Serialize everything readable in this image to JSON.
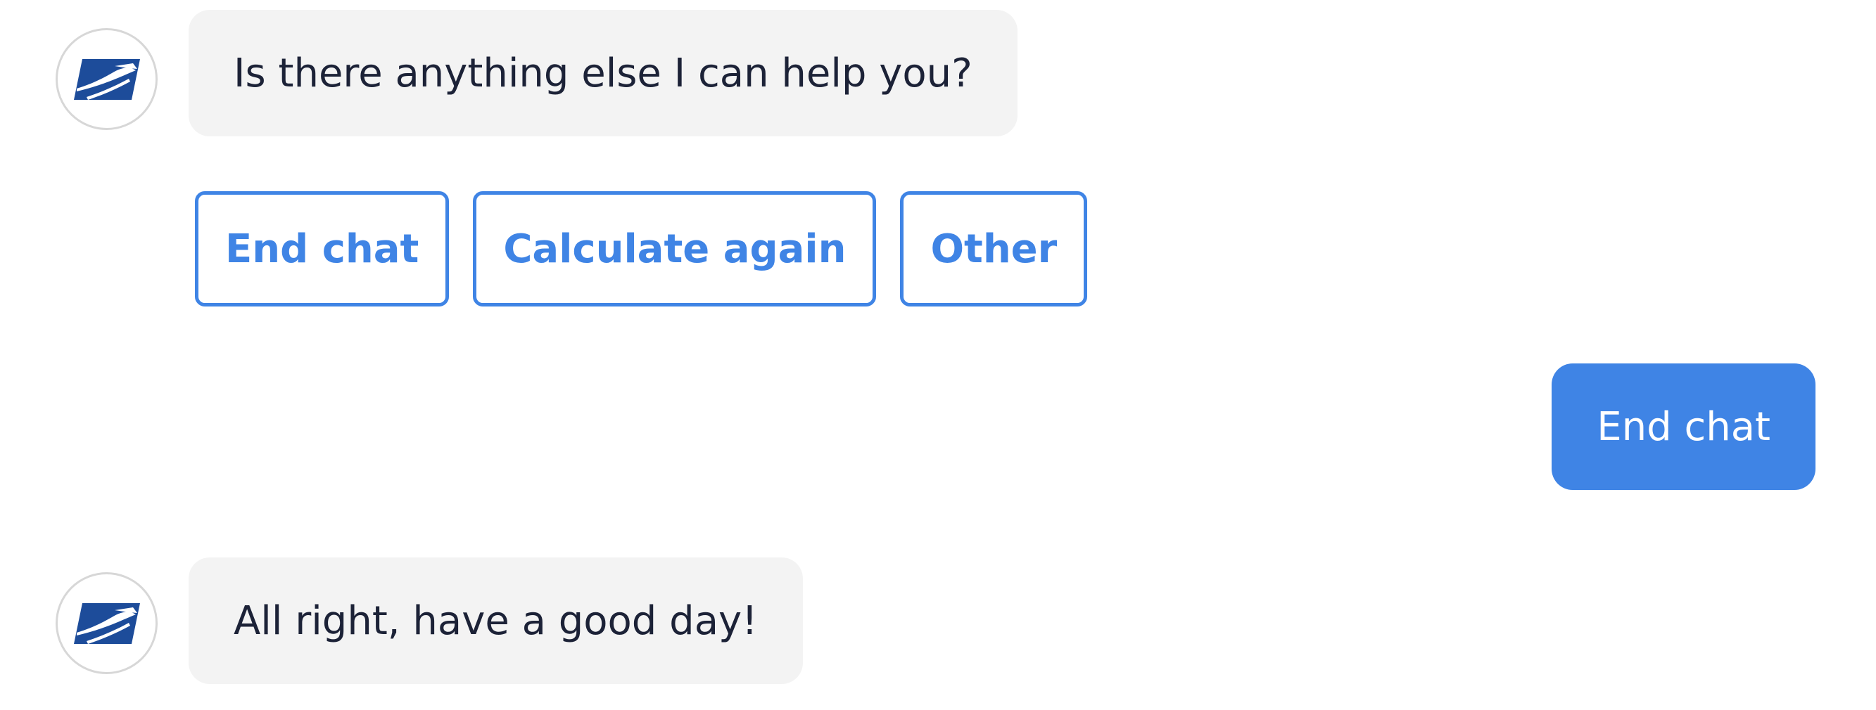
{
  "messages": {
    "bot_question": "Is there anything else I can help you?",
    "user_reply": "End chat",
    "bot_farewell": "All right, have a good day!"
  },
  "quick_replies": [
    {
      "label": "End chat"
    },
    {
      "label": "Calculate again"
    },
    {
      "label": "Other"
    }
  ],
  "avatar": {
    "icon": "usps-eagle-logo-icon",
    "color": "#1d4c9a"
  },
  "colors": {
    "accent": "#3f84e5",
    "bot_bubble": "#f3f3f3",
    "bot_text": "#1c2237",
    "user_text": "#ffffff"
  }
}
